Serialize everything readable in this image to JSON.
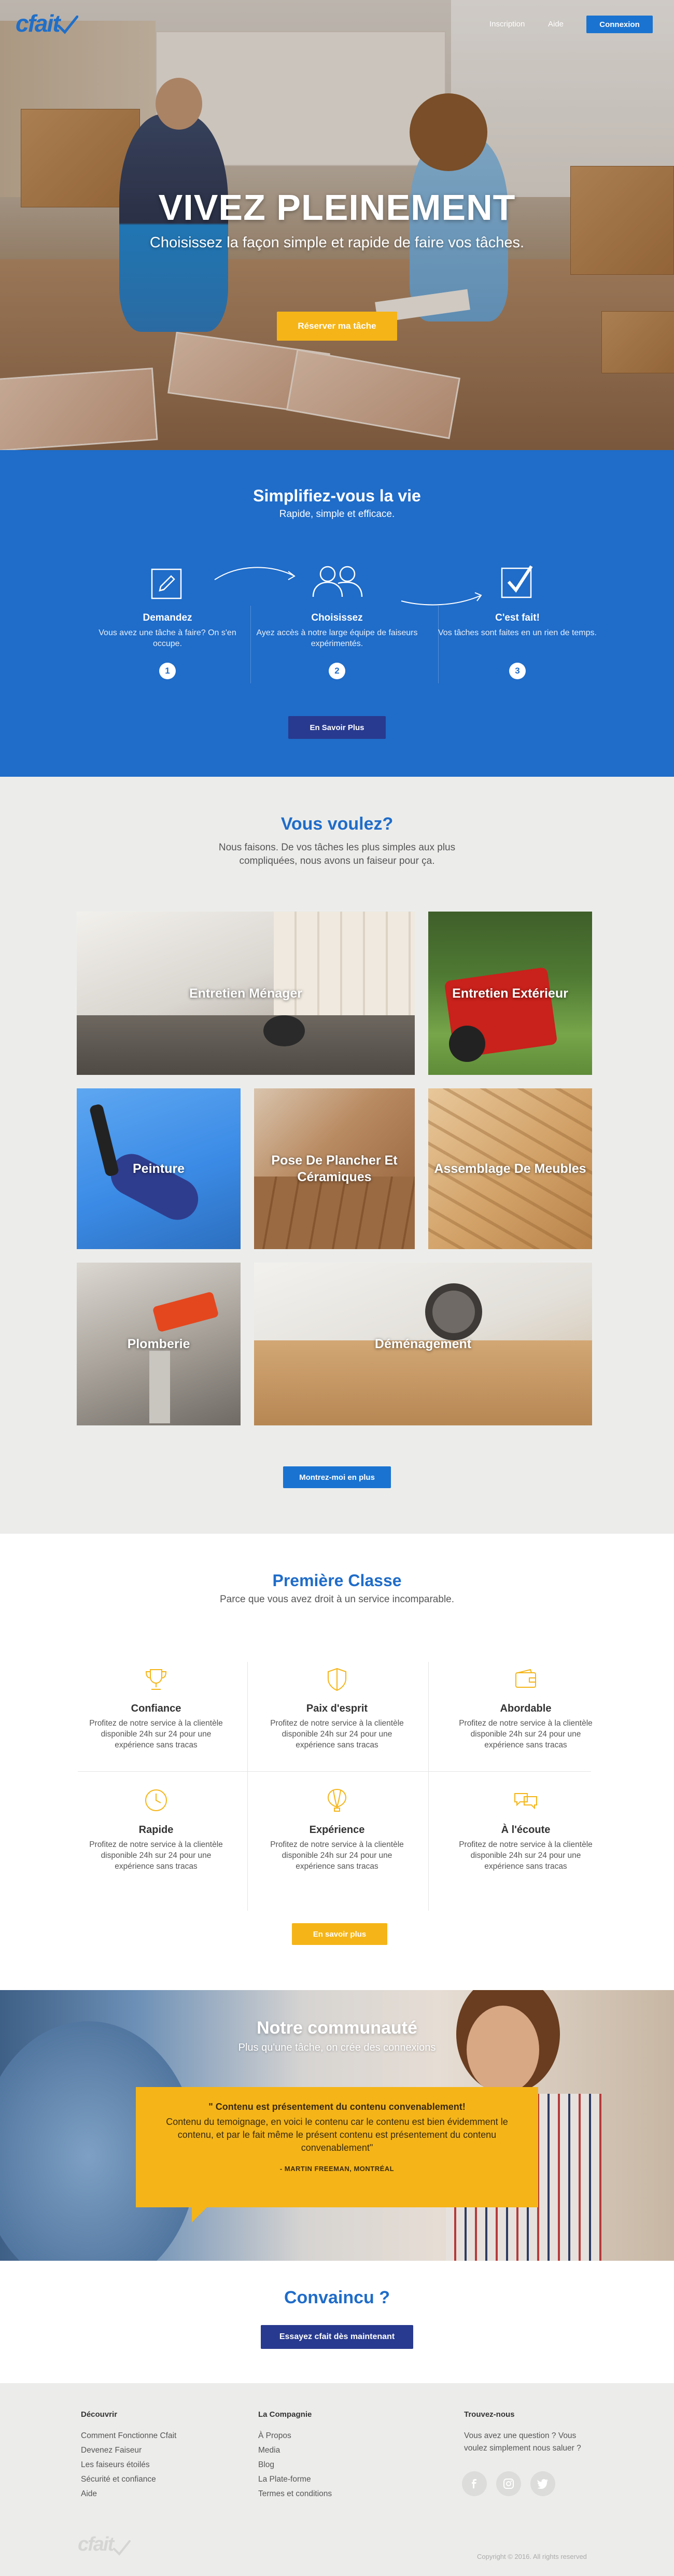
{
  "header": {
    "logo_text": "cfait",
    "nav": [
      "Inscription",
      "Aide"
    ],
    "login_label": "Connexion"
  },
  "hero": {
    "title": "VIVEZ PLEINEMENT",
    "subtitle": "Choisissez la façon simple et rapide de faire vos tâches.",
    "cta": "Réserver ma tâche"
  },
  "how": {
    "title": "Simplifiez-vous la vie",
    "subtitle": "Rapide, simple et efficace.",
    "steps": [
      {
        "title": "Demandez",
        "desc": "Vous avez une tâche à faire? On s'en occupe.",
        "num": "1",
        "icon": "pencil-icon"
      },
      {
        "title": "Choisissez",
        "desc": "Ayez accès à notre large équipe de faiseurs  expérimentés.",
        "num": "2",
        "icon": "people-icon"
      },
      {
        "title": "C'est fait!",
        "desc": "Vos tâches sont faites en un rien de temps.",
        "num": "3",
        "icon": "checkbox-icon"
      }
    ],
    "cta": "En Savoir Plus"
  },
  "services": {
    "title": "Vous voulez?",
    "subtitle": "Nous faisons. De vos tâches les plus simples aux plus compliquées, nous avons un faiseur pour ça.",
    "tiles": [
      {
        "label": "Entretien Ménager"
      },
      {
        "label": "Entretien Extérieur"
      },
      {
        "label": "Peinture"
      },
      {
        "label": "Pose De Plancher Et Céramiques"
      },
      {
        "label": "Assemblage De Meubles"
      },
      {
        "label": "Plomberie"
      },
      {
        "label": "Déménagement"
      }
    ],
    "cta": "Montrez-moi en plus"
  },
  "premiere": {
    "title": "Première Classe",
    "subtitle": "Parce que vous avez droit à un service incomparable.",
    "features": [
      {
        "title": "Confiance",
        "desc": "Profitez de notre service à la clientèle disponible 24h sur 24 pour une expérience sans tracas",
        "icon": "trophy-icon"
      },
      {
        "title": "Paix d'esprit",
        "desc": "Profitez de notre service à la clientèle disponible 24h sur 24 pour une expérience sans tracas",
        "icon": "shield-icon"
      },
      {
        "title": "Abordable",
        "desc": "Profitez de notre service à la clientèle disponible 24h sur 24 pour une expérience sans tracas",
        "icon": "wallet-icon"
      },
      {
        "title": "Rapide",
        "desc": "Profitez de notre service à la clientèle disponible 24h sur 24 pour une expérience sans tracas",
        "icon": "clock-icon"
      },
      {
        "title": "Expérience",
        "desc": "Profitez de notre service à la clientèle disponible 24h sur 24 pour une expérience sans tracas",
        "icon": "balloon-icon"
      },
      {
        "title": "À l'écoute",
        "desc": "Profitez de notre service à la clientèle disponible 24h sur 24 pour une expérience sans tracas",
        "icon": "chat-icon"
      }
    ],
    "cta": "En savoir plus"
  },
  "community": {
    "title": "Notre communauté",
    "subtitle": "Plus qu'une tâche, on crée des connexions",
    "quote_head": "\" Contenu est présentement du contenu convenablement!",
    "quote_body": "Contenu du temoignage, en voici le contenu car le contenu est bien évidemment le contenu, et par le fait même le présent contenu est présentement du contenu convenablement\"",
    "author": "- MARTIN FREEMAN, MONTRÉAL"
  },
  "convaincu": {
    "title": "Convaincu ?",
    "cta": "Essayez cfait dès maintenant"
  },
  "footer": {
    "col1": {
      "title": "Découvrir",
      "links": [
        "Comment Fonctionne Cfait",
        "Devenez Faiseur",
        "Les faiseurs étoilés",
        "Sécurité et confiance",
        "Aide"
      ]
    },
    "col2": {
      "title": "La Compagnie",
      "links": [
        "À Propos",
        "Media",
        "Blog",
        "La Plate-forme",
        "Termes et conditions"
      ]
    },
    "col3": {
      "title": "Trouvez-nous",
      "text": "Vous avez une question ? Vous voulez simplement nous saluer ?"
    },
    "social": [
      "facebook-icon",
      "instagram-icon",
      "twitter-icon"
    ],
    "logo_text": "cfait",
    "copyright": "Copyright © 2016. All rights reserved"
  },
  "colors": {
    "brand_blue": "#1f6cc9",
    "accent_yellow": "#f5b518",
    "navy": "#283a8f"
  }
}
